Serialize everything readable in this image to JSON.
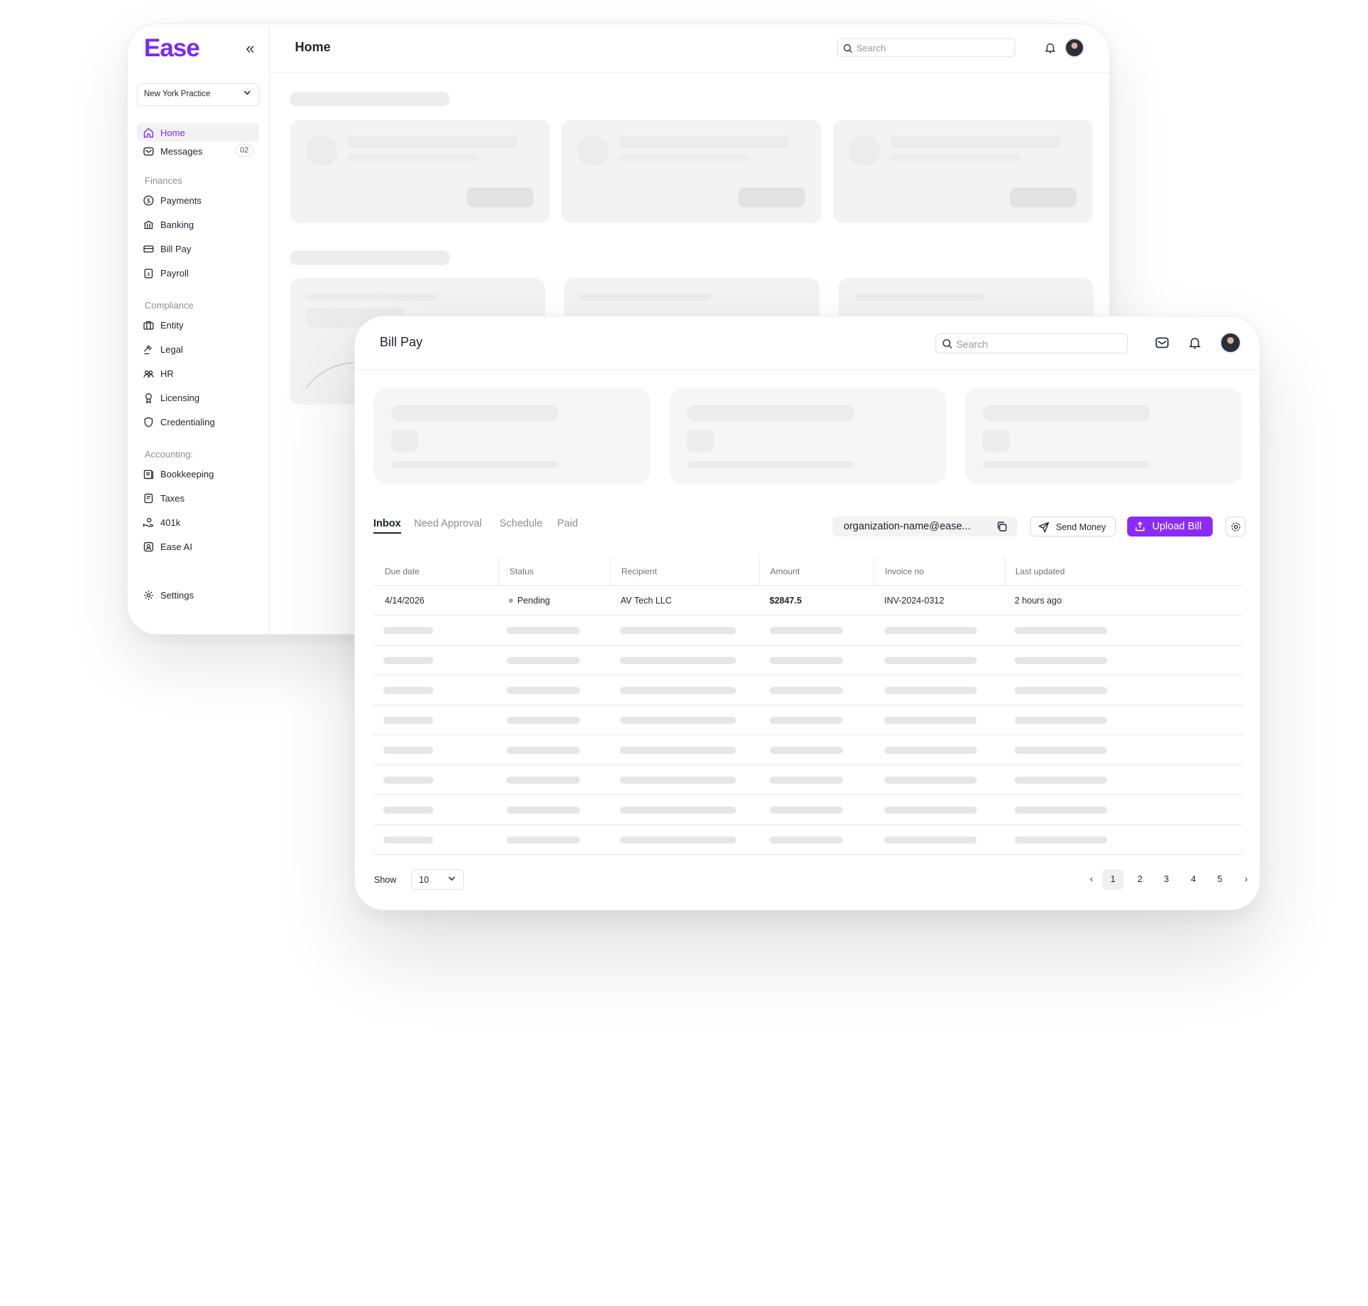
{
  "home_window": {
    "logo": "Ease",
    "collapse_glyph": "«",
    "practice_selector": "New York Practice",
    "title": "Home",
    "search_placeholder": "Search",
    "nav": {
      "home": "Home",
      "messages": "Messages",
      "messages_badge": "02",
      "section_finances": "Finances",
      "payments": "Payments",
      "banking": "Banking",
      "bill_pay": "Bill Pay",
      "payroll": "Payroll",
      "section_compliance": "Compliance",
      "entity": "Entity",
      "legal": "Legal",
      "hr": "HR",
      "licensing": "Licensing",
      "credentialing": "Credentialing",
      "section_accounting": "Accounting:",
      "bookkeeping": "Bookkeeping",
      "taxes": "Taxes",
      "k401": "401k",
      "ease_ai": "Ease AI",
      "settings": "Settings"
    }
  },
  "bill_window": {
    "title": "Bill Pay",
    "search_placeholder": "Search",
    "tabs": [
      "Inbox",
      "Need Approval",
      "Schedule",
      "Paid"
    ],
    "email": "organization-name@ease...",
    "send_money": "Send Money",
    "upload_bill": "Upload Bill",
    "columns": [
      "Due date",
      "Status",
      "Recipient",
      "Amount",
      "Invoice no",
      "Last updated"
    ],
    "row": {
      "due_date": "4/14/2026",
      "status": "Pending",
      "recipient": "AV Tech LLC",
      "amount": "$2847.5",
      "invoice_no": "INV-2024-0312",
      "last_updated": "2 hours ago"
    },
    "show_label": "Show",
    "page_size": "10",
    "pagination": {
      "prev": "‹",
      "pages": [
        "1",
        "2",
        "3",
        "4",
        "5"
      ],
      "next": "›",
      "current": "1"
    }
  },
  "colors": {
    "brand": "#7c2ae8",
    "primary_button": "#8b2cf5",
    "skeleton": "#ececec"
  },
  "icons": [
    "collapse-sidebar-icon",
    "chevron-down-icon",
    "home-icon",
    "mail-icon",
    "dollar-icon",
    "bank-icon",
    "card-icon",
    "payroll-icon",
    "briefcase-icon",
    "gavel-icon",
    "users-icon",
    "award-icon",
    "shield-icon",
    "book-icon",
    "receipt-icon",
    "hand-coin-icon",
    "ai-icon",
    "gear-icon",
    "search-icon",
    "bell-icon",
    "copy-icon",
    "send-icon",
    "upload-icon"
  ]
}
